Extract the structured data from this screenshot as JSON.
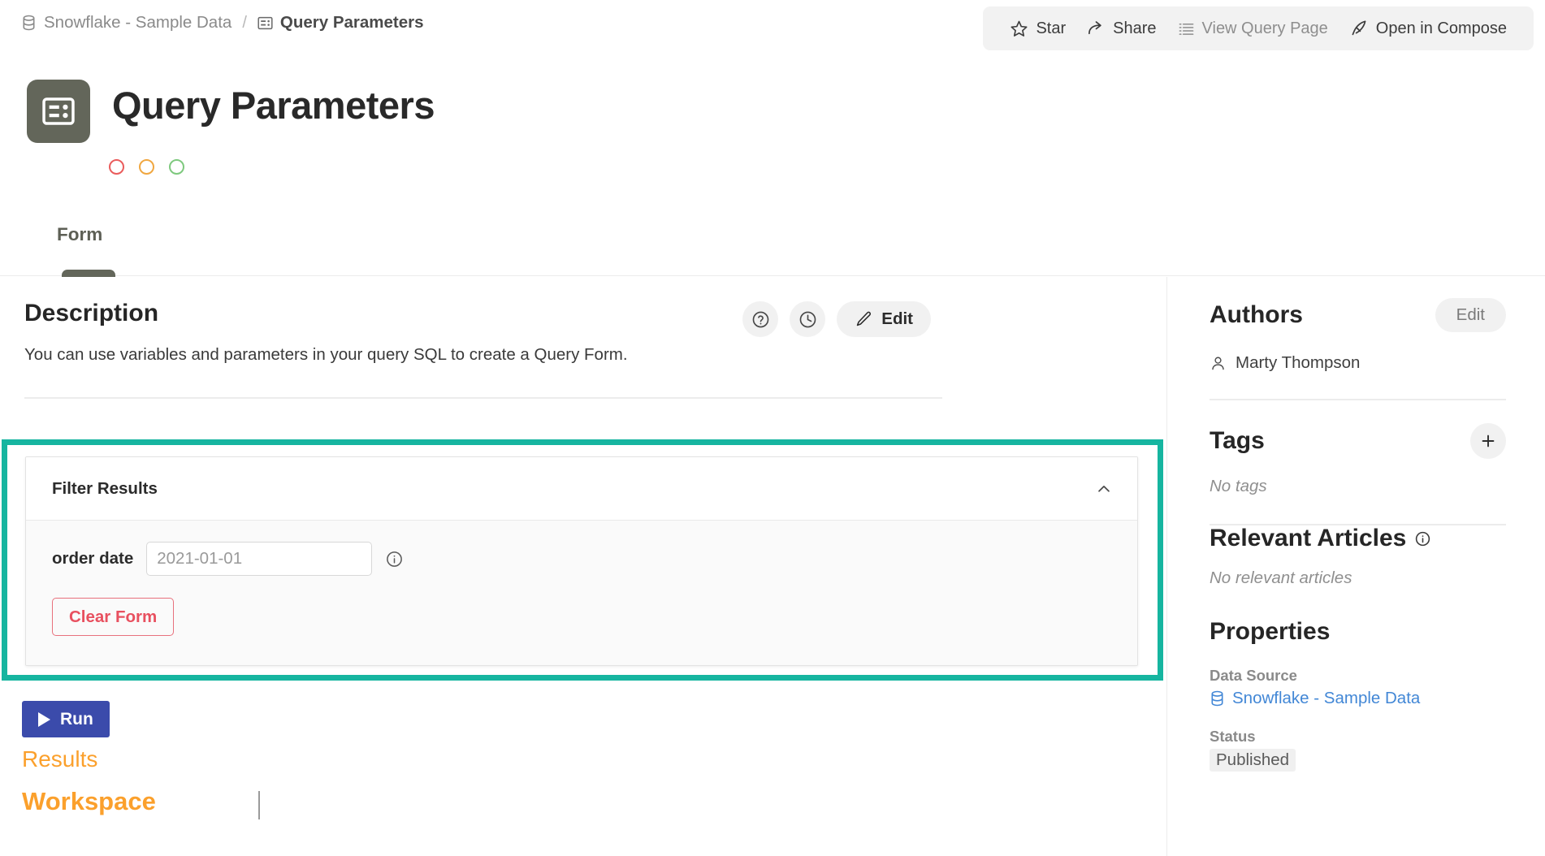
{
  "breadcrumb": {
    "source": "Snowflake - Sample Data",
    "separator": "/",
    "current": "Query Parameters"
  },
  "actions": [
    {
      "label": "Star",
      "icon": "star-icon",
      "muted": false
    },
    {
      "label": "Share",
      "icon": "share-icon",
      "muted": false
    },
    {
      "label": "View Query Page",
      "icon": "list-icon",
      "muted": true
    },
    {
      "label": "Open in Compose",
      "icon": "quill-icon",
      "muted": false
    }
  ],
  "header": {
    "title": "Query Parameters",
    "icon": "query-form-icon",
    "icon_bg": "#63665a",
    "status_dots": [
      {
        "name": "red-dot",
        "color": "#ea5c5c"
      },
      {
        "name": "orange-dot",
        "color": "#f0a740"
      },
      {
        "name": "green-dot",
        "color": "#7ec97e"
      }
    ]
  },
  "tabs": [
    {
      "label": "Form",
      "active": true
    }
  ],
  "description": {
    "title": "Description",
    "body": "You can use variables and parameters in your query SQL to create a Query Form.",
    "help_icon": "question-circle-icon",
    "history_icon": "clock-icon",
    "edit_label": "Edit",
    "edit_icon": "pencil-icon"
  },
  "form_card": {
    "title": "Filter Results",
    "collapse_icon": "chevron-up-icon",
    "highlight_color": "#16b5a0",
    "field": {
      "label": "order date",
      "value": "",
      "placeholder": "2021-01-01",
      "info_icon": "info-circle-icon"
    },
    "clear_label": "Clear Form"
  },
  "run": {
    "label": "Run",
    "icon": "play-icon",
    "color": "#3b4bab"
  },
  "results": {
    "label": "Results",
    "workspace_label": "Workspace",
    "color": "#fba02c"
  },
  "sidebar": {
    "authors": {
      "title": "Authors",
      "edit_label": "Edit",
      "items": [
        {
          "name": "Marty Thompson",
          "icon": "user-icon"
        }
      ]
    },
    "tags": {
      "title": "Tags",
      "add_icon": "plus-icon",
      "empty": "No tags"
    },
    "relevant_articles": {
      "title": "Relevant Articles",
      "info_icon": "info-circle-icon",
      "empty": "No relevant articles"
    },
    "properties": {
      "title": "Properties",
      "data_source_label": "Data Source",
      "data_source_value": "Snowflake - Sample Data",
      "data_source_icon": "database-icon",
      "status_label": "Status",
      "status_value": "Published"
    }
  }
}
